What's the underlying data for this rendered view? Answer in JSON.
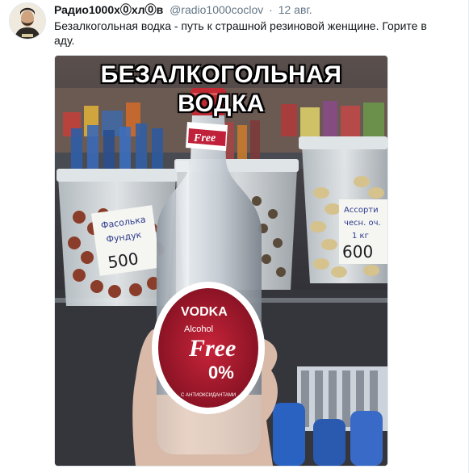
{
  "tweet": {
    "author_name": "Радио1000х⓪хл⓪в",
    "handle": "@radio1000coclov",
    "separator": "·",
    "time": "12 авг.",
    "text": "Безалкогольная водка - путь к страшной резиновой женщине. Горите в аду."
  },
  "media": {
    "caption": "БЕЗАЛКОГОЛЬНАЯ ВОДКА",
    "label": {
      "brand_top": "Free",
      "vodka": "VODKA",
      "alcohol": "Alcohol",
      "free": "Free",
      "percent": "0%",
      "sub": "С АНТИОКСИДАНТАМИ"
    },
    "left_tag": {
      "line1": "Фасолька",
      "line2": "Фундук",
      "price": "500"
    },
    "right_tag": {
      "line1": "Ассорти",
      "line2": "чесн. оч.",
      "line3": "1 кг",
      "price": "600"
    }
  },
  "colors": {
    "name": "#14171a",
    "muted": "#657786",
    "label_red": "#b01c2e"
  }
}
